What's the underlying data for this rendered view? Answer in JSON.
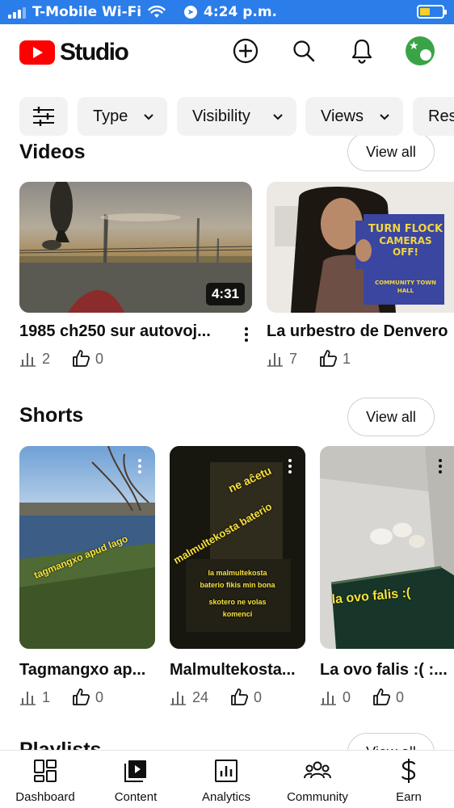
{
  "status_bar": {
    "carrier": "T-Mobile Wi-Fi",
    "time": "4:24 p.m."
  },
  "header": {
    "logo_text": "Studio",
    "icons": [
      "add-icon",
      "search-icon",
      "bell-icon",
      "avatar"
    ]
  },
  "filters": {
    "chips": [
      {
        "label": ""
      },
      {
        "label": "Type"
      },
      {
        "label": "Visibility"
      },
      {
        "label": "Views"
      },
      {
        "label": "Res"
      }
    ]
  },
  "videos": {
    "title": "Videos",
    "view_all": "View all",
    "items": [
      {
        "title": "1985 ch250 sur autovoj...",
        "duration": "4:31",
        "views": "2",
        "likes": "0"
      },
      {
        "title": "La urbestro de Denvero",
        "views": "7",
        "likes": "1",
        "poster": {
          "line1": "TURN FLOCK",
          "line2": "CAMERAS OFF!",
          "line3": "COMMUNITY TOWN HALL"
        }
      }
    ]
  },
  "shorts": {
    "title": "Shorts",
    "view_all": "View all",
    "items": [
      {
        "title": "Tagmangxo ap...",
        "views": "1",
        "likes": "0",
        "overlay": "tagmangxo apud lago"
      },
      {
        "title": "Malmultekosta...",
        "views": "24",
        "likes": "0",
        "overlay_top": "ne aĉetu",
        "overlay_main": "malmultekosta baterio",
        "overlay_small": [
          "la malmultekosta",
          "baterio fikis min bona",
          "skotero ne volas",
          "komenci"
        ]
      },
      {
        "title": "La ovo falis :( :...",
        "views": "0",
        "likes": "0",
        "overlay": "la ovo falis :("
      }
    ]
  },
  "playlists": {
    "title": "Playlists",
    "view_all": "View all"
  },
  "bottom_nav": {
    "items": [
      {
        "label": "Dashboard",
        "icon": "dashboard-icon"
      },
      {
        "label": "Content",
        "icon": "content-icon"
      },
      {
        "label": "Analytics",
        "icon": "analytics-icon"
      },
      {
        "label": "Community",
        "icon": "community-icon"
      },
      {
        "label": "Earn",
        "icon": "earn-icon"
      }
    ]
  },
  "colors": {
    "status_bar": "#2b7de9",
    "brand_red": "#ff0000",
    "overlay_yellow": "#f7e33b"
  }
}
